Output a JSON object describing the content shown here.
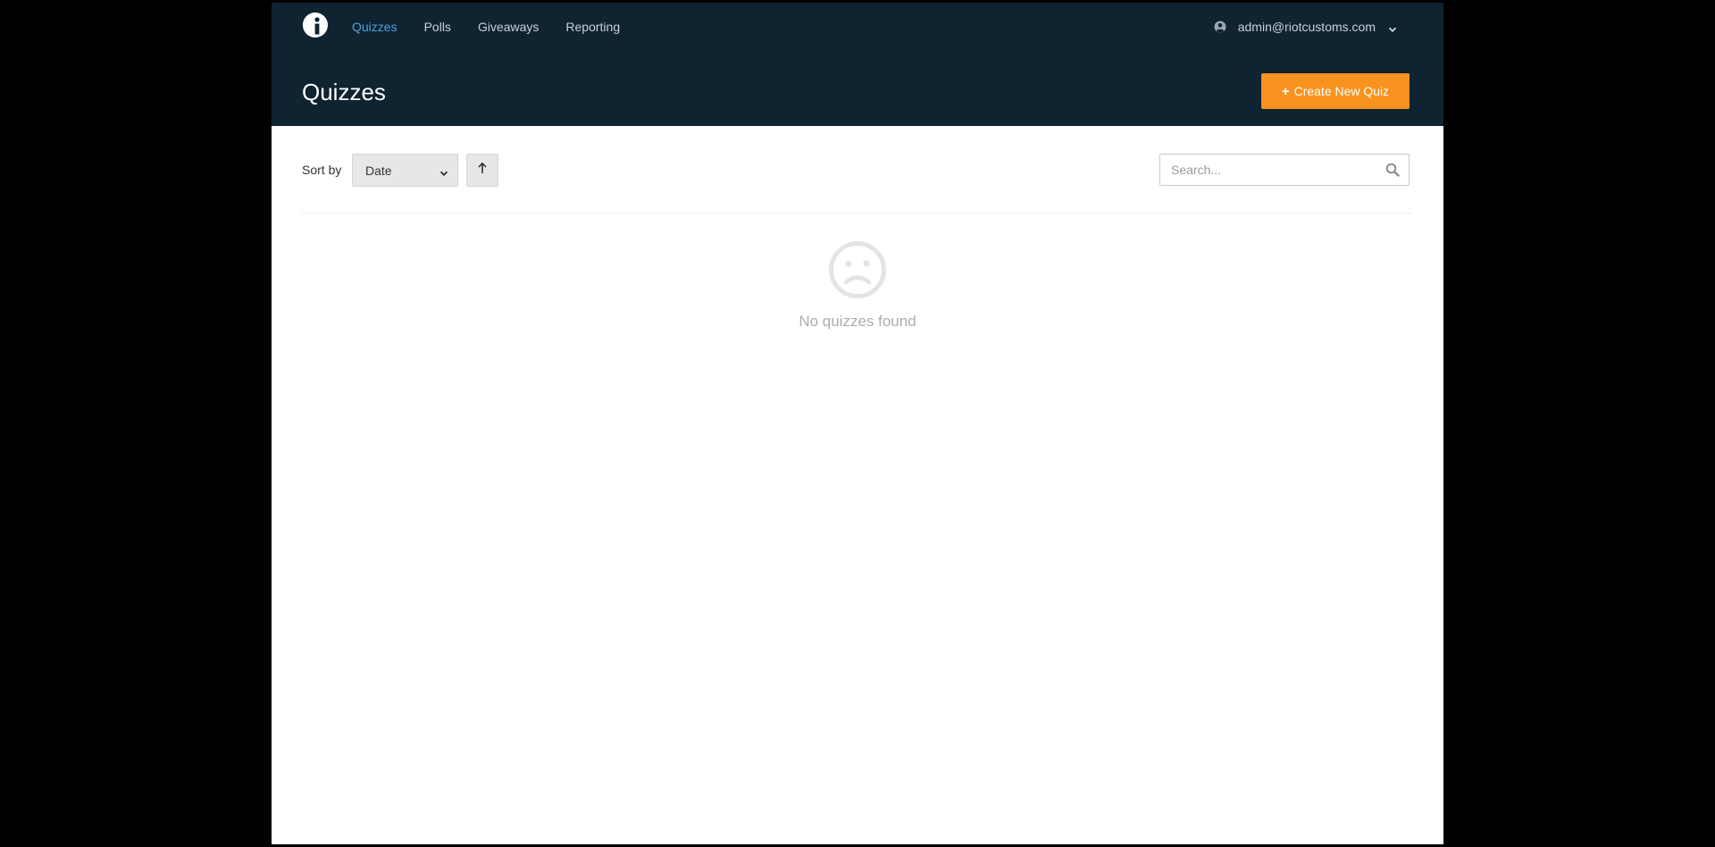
{
  "header": {
    "nav": [
      {
        "label": "Quizzes",
        "active": true
      },
      {
        "label": "Polls",
        "active": false
      },
      {
        "label": "Giveaways",
        "active": false
      },
      {
        "label": "Reporting",
        "active": false
      }
    ],
    "user": {
      "email": "admin@riotcustoms.com",
      "icon": "user-circle-icon"
    },
    "page_title": "Quizzes",
    "create_button": {
      "icon": "plus",
      "label": "Create New Quiz"
    }
  },
  "toolbar": {
    "sort_label": "Sort by",
    "sort_value": "Date",
    "sort_direction_icon": "arrow-up-icon",
    "search_placeholder": "Search..."
  },
  "empty_state": {
    "icon": "sad-face-icon",
    "message": "No quizzes found"
  },
  "colors": {
    "header_bg": "#0f2330",
    "nav_active": "#4aa3df",
    "accent": "#f7931e",
    "page_bg": "#ffffff"
  }
}
